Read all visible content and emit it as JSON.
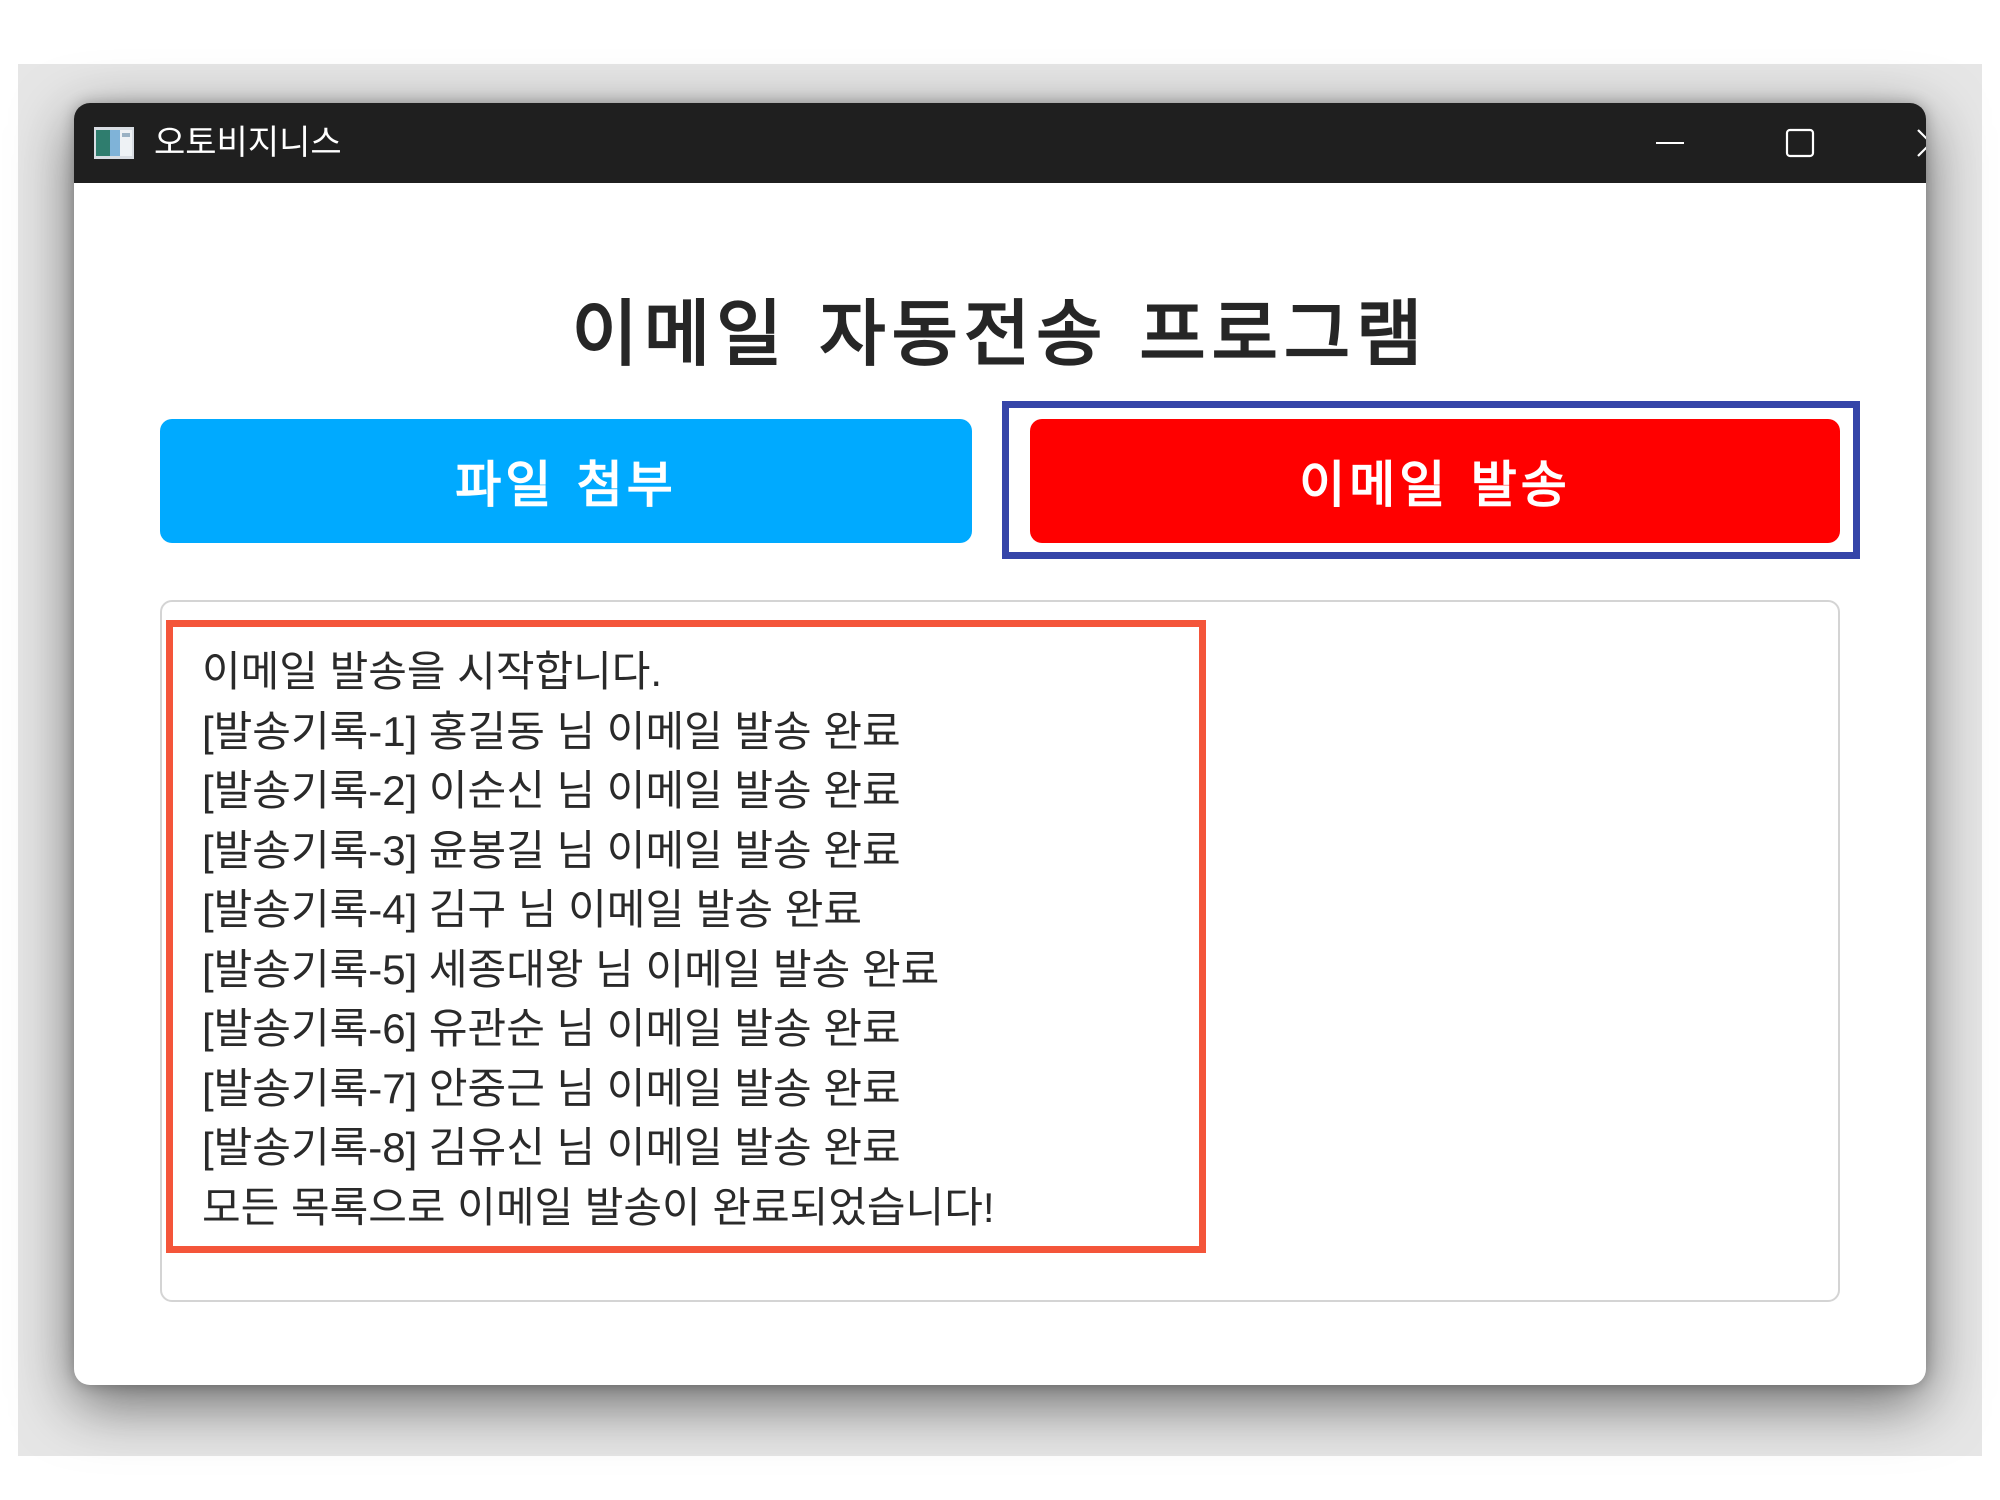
{
  "window": {
    "title": "오토비지니스",
    "controls": {
      "minimize": "minimize-icon",
      "maximize": "maximize-icon",
      "close": "close-icon"
    }
  },
  "main": {
    "heading": "이메일 자동전송 프로그램",
    "attach_button": "파일 첨부",
    "send_button": "이메일 발송",
    "log_lines": [
      "이메일 발송을 시작합니다.",
      "[발송기록-1] 홍길동 님 이메일 발송 완료",
      "[발송기록-2] 이순신 님 이메일 발송 완료",
      "[발송기록-3] 윤봉길 님 이메일 발송 완료",
      "[발송기록-4] 김구 님 이메일 발송 완료",
      "[발송기록-5] 세종대왕 님 이메일 발송 완료",
      "[발송기록-6] 유관순 님 이메일 발송 완료",
      "[발송기록-7] 안중근 님 이메일 발송 완료",
      "[발송기록-8] 김유신 님 이메일 발송 완료",
      "모든 목록으로 이메일 발송이 완료되었습니다!"
    ]
  },
  "colors": {
    "titlebar": "#1f1f1f",
    "attach_button": "#00aaff",
    "send_button": "#ff0000",
    "send_highlight": "#3545a8",
    "log_highlight": "#f4553a"
  }
}
